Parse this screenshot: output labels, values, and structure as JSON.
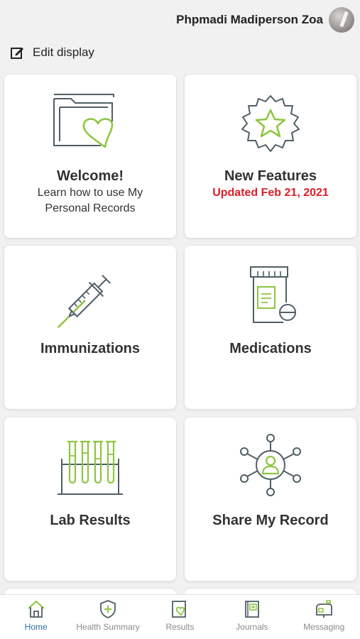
{
  "header": {
    "user_name": "Phpmadi Madiperson Zoa",
    "edit_label": "Edit display"
  },
  "cards": [
    {
      "title": "Welcome!",
      "subtitle": "Learn how to use My Personal Records",
      "icon": "folder-heart-icon"
    },
    {
      "title": "New Features",
      "subtitle": "Updated Feb 21, 2021",
      "icon": "star-badge-icon"
    },
    {
      "title": "Immunizations",
      "icon": "syringe-icon"
    },
    {
      "title": "Medications",
      "icon": "pill-bottle-icon"
    },
    {
      "title": "Lab Results",
      "icon": "test-tubes-icon"
    },
    {
      "title": "Share My Record",
      "icon": "share-network-icon"
    }
  ],
  "bottom_nav": [
    {
      "label": "Home",
      "icon": "home-icon",
      "active": true
    },
    {
      "label": "Health Summary",
      "icon": "shield-cross-icon",
      "active": false
    },
    {
      "label": "Results",
      "icon": "results-icon",
      "active": false
    },
    {
      "label": "Journals",
      "icon": "journal-icon",
      "active": false
    },
    {
      "label": "Messaging",
      "icon": "mailbox-icon",
      "active": false
    }
  ],
  "colors": {
    "accent_green": "#8cc63f",
    "icon_gray": "#4f5f66",
    "alert_red": "#d9202a",
    "nav_active": "#2f6fa3",
    "nav_inactive": "#8a8a8a"
  }
}
